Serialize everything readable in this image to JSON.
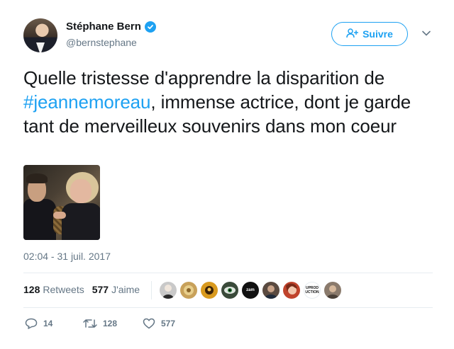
{
  "user": {
    "display_name": "Stéphane Bern",
    "handle": "@bernstephane",
    "verified": true,
    "avatar_icon": "profile-photo"
  },
  "follow_button": {
    "label": "Suivre",
    "icon": "add-user-icon"
  },
  "menu_icon": "chevron-down-icon",
  "tweet": {
    "text_before": "Quelle tristesse d'apprendre la disparition de ",
    "hashtag": "#jeannemoreau",
    "text_after": ", immense actrice, dont je garde tant de merveilleux souvenirs dans mon coeur",
    "image": "photo of two people seated together"
  },
  "timestamp": "02:04 - 31 juil. 2017",
  "stats": {
    "retweets_count": "128",
    "retweets_label": "Retweets",
    "likes_count": "577",
    "likes_label": "J'aime"
  },
  "likers": [
    {
      "name": "liker-1",
      "color": "#c9c9c9"
    },
    {
      "name": "liker-2",
      "color": "#c8a15a"
    },
    {
      "name": "liker-3",
      "color": "#d99a1e"
    },
    {
      "name": "liker-4",
      "color": "#3a4a3a"
    },
    {
      "name": "liker-5",
      "color": "#111111",
      "text": "zam"
    },
    {
      "name": "liker-6",
      "color": "#5a4a40"
    },
    {
      "name": "liker-7",
      "color": "#c0432c"
    },
    {
      "name": "liker-8",
      "color": "#ffffff",
      "text": "UPROD UCTION"
    },
    {
      "name": "liker-9",
      "color": "#8a7a6c"
    }
  ],
  "actions": {
    "replies": "14",
    "retweets": "128",
    "likes": "577"
  },
  "colors": {
    "accent": "#1da1f2",
    "muted": "#657786",
    "text": "#14171a",
    "divider": "#e6ecf0"
  }
}
